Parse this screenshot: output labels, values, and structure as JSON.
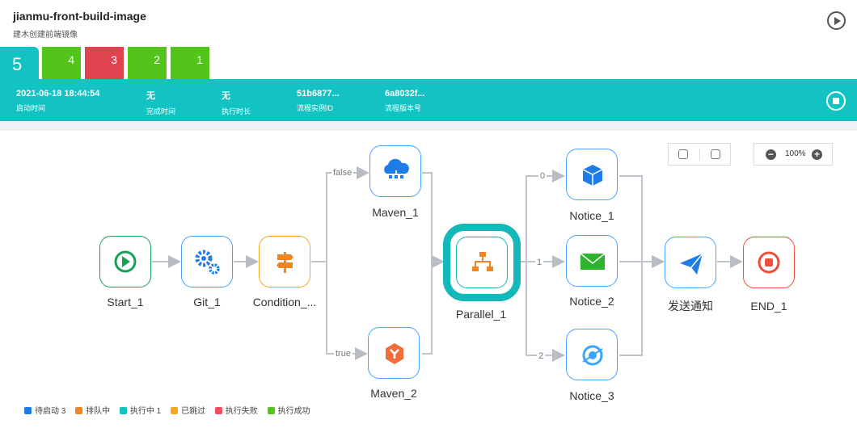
{
  "header": {
    "title": "jianmu-front-build-image",
    "subtitle": "建木创建前端镜像"
  },
  "tabs": [
    {
      "label": "5",
      "color": "#13c2c2",
      "active": true
    },
    {
      "label": "4",
      "color": "#52c41a"
    },
    {
      "label": "3",
      "color": "#e04350"
    },
    {
      "label": "2",
      "color": "#52c41a"
    },
    {
      "label": "1",
      "color": "#52c41a"
    }
  ],
  "info": [
    {
      "value": "2021-06-18 18:44:54",
      "key": "启动时间"
    },
    {
      "value": "无",
      "key": "完成时间"
    },
    {
      "value": "无",
      "key": "执行时长"
    },
    {
      "value": "51b6877...",
      "key": "流程实例ID"
    },
    {
      "value": "6a8032f...",
      "key": "流程版本号"
    }
  ],
  "zoom": {
    "value": "100%"
  },
  "nodes": {
    "start": {
      "label": "Start_1",
      "icon": "play-icon",
      "color": "#18a058"
    },
    "git": {
      "label": "Git_1",
      "icon": "gears-icon",
      "color": "#1e7ce8"
    },
    "condition": {
      "label": "Condition_...",
      "icon": "signpost-icon",
      "color": "#f5a623"
    },
    "maven1": {
      "label": "Maven_1",
      "icon": "cloud-network-icon",
      "color": "#1e7ce8"
    },
    "maven2": {
      "label": "Maven_2",
      "icon": "hexagon-y-icon",
      "color": "#f06d3a"
    },
    "parallel": {
      "label": "Parallel_1",
      "icon": "hierarchy-icon",
      "color": "#f08522"
    },
    "notice1": {
      "label": "Notice_1",
      "icon": "cube-icon",
      "color": "#1e7ce8"
    },
    "notice2": {
      "label": "Notice_2",
      "icon": "mail-icon",
      "color": "#2db42d"
    },
    "notice3": {
      "label": "Notice_3",
      "icon": "ring-icon",
      "color": "#3aa5ff"
    },
    "notify": {
      "label": "发送通知",
      "icon": "paper-plane-icon",
      "color": "#1e7ce8"
    },
    "end": {
      "label": "END_1",
      "icon": "stop-icon",
      "color": "#f04e3a"
    }
  },
  "edge_labels": {
    "false": "false",
    "true": "true",
    "zero": "0",
    "one": "1",
    "two": "2"
  },
  "legend": [
    {
      "label": "待启动 3",
      "color": "#1e7ce8"
    },
    {
      "label": "排队中",
      "color": "#f08522"
    },
    {
      "label": "执行中 1",
      "color": "#13c2c2"
    },
    {
      "label": "已跳过",
      "color": "#f5a623"
    },
    {
      "label": "执行失败",
      "color": "#f04e5a"
    },
    {
      "label": "执行成功",
      "color": "#52c41a"
    }
  ]
}
